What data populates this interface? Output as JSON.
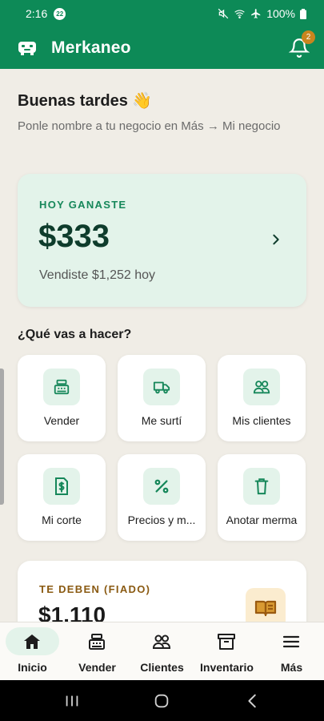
{
  "status": {
    "time": "2:16",
    "notif_count": "22",
    "battery": "100%"
  },
  "app": {
    "title": "Merkaneo",
    "notification_count": "2"
  },
  "greeting": {
    "title": "Buenas tardes 👋",
    "subtitle": "Ponle nombre a tu negocio en Más → Mi negocio"
  },
  "earnings": {
    "label": "HOY GANASTE",
    "amount": "$333",
    "detail": "Vendiste $1,252 hoy"
  },
  "actions": {
    "title": "¿Qué vas a hacer?",
    "items": [
      {
        "label": "Vender",
        "icon": "cash-register-icon"
      },
      {
        "label": "Me surtí",
        "icon": "truck-icon"
      },
      {
        "label": "Mis clientes",
        "icon": "users-icon"
      },
      {
        "label": "Mi corte",
        "icon": "money-receipt-icon"
      },
      {
        "label": "Precios y m...",
        "icon": "percent-icon"
      },
      {
        "label": "Anotar merma",
        "icon": "trash-icon"
      }
    ]
  },
  "fiado": {
    "label": "TE DEBEN (FIADO)",
    "amount": "$1,110",
    "icon": "book-icon"
  },
  "bottom_nav": [
    {
      "label": "Inicio",
      "icon": "home-icon",
      "active": true
    },
    {
      "label": "Vender",
      "icon": "cash-register-icon",
      "active": false
    },
    {
      "label": "Clientes",
      "icon": "users-icon",
      "active": false
    },
    {
      "label": "Inventario",
      "icon": "archive-icon",
      "active": false
    },
    {
      "label": "Más",
      "icon": "menu-icon",
      "active": false
    }
  ],
  "colors": {
    "brand": "#0d8a57",
    "accent_light": "#e3f3ea",
    "fiado": "#8a5a12",
    "badge": "#c9851e"
  }
}
